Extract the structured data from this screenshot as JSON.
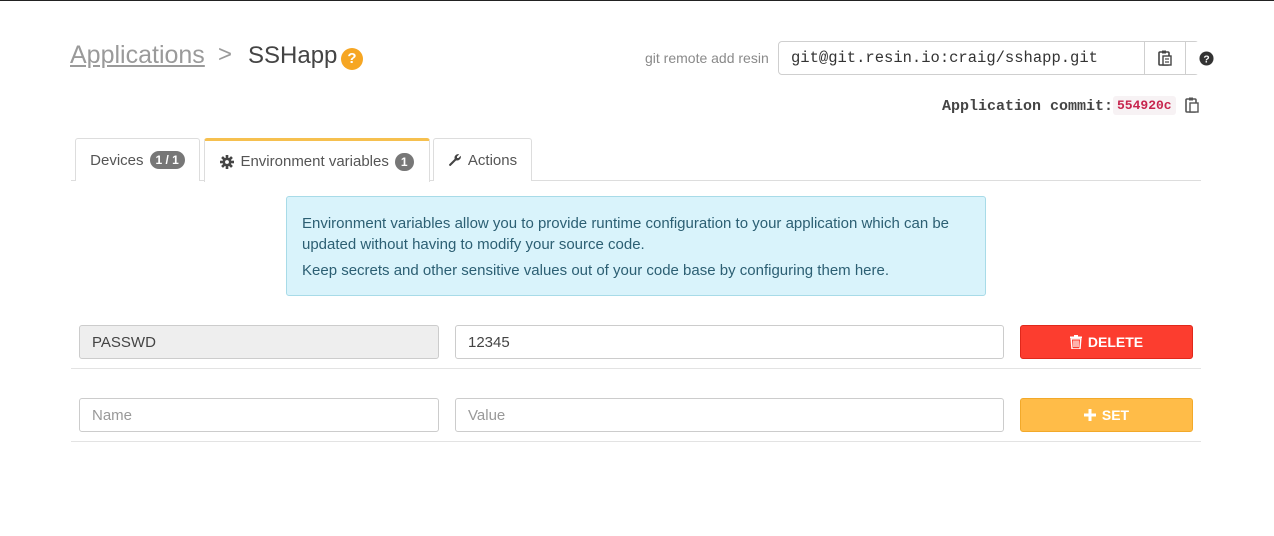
{
  "breadcrumb": {
    "applications": "Applications",
    "separator": ">",
    "app_name": "SSHapp",
    "help_glyph": "?"
  },
  "git": {
    "label": "git remote add resin",
    "remote_url": "git@git.resin.io:craig/sshapp.git",
    "copy_icon": "clipboard-icon",
    "help_icon": "question-circle-icon"
  },
  "commit": {
    "label": "Application commit:",
    "hash": "554920c"
  },
  "tabs": [
    {
      "label": "Devices",
      "badge": "1 / 1",
      "active": false
    },
    {
      "label": "Environment variables",
      "badge": "1",
      "icon": "gear-icon",
      "active": true
    },
    {
      "label": "Actions",
      "icon": "wrench-icon",
      "active": false
    }
  ],
  "info": {
    "line1": "Environment variables allow you to provide runtime configuration to your application which can be updated without having to modify your source code.",
    "line2": "Keep secrets and other sensitive values out of your code base by configuring them here."
  },
  "variables": [
    {
      "name": "PASSWD",
      "value": "12345",
      "delete_label": "DELETE"
    }
  ],
  "new_var": {
    "name_placeholder": "Name",
    "value_placeholder": "Value",
    "set_label": "SET"
  },
  "colors": {
    "accent": "#f6a623",
    "delete": "#fc3d2f",
    "set": "#ffbc48",
    "info_bg": "#d9f3fb",
    "commit_hash": "#c7254e"
  }
}
